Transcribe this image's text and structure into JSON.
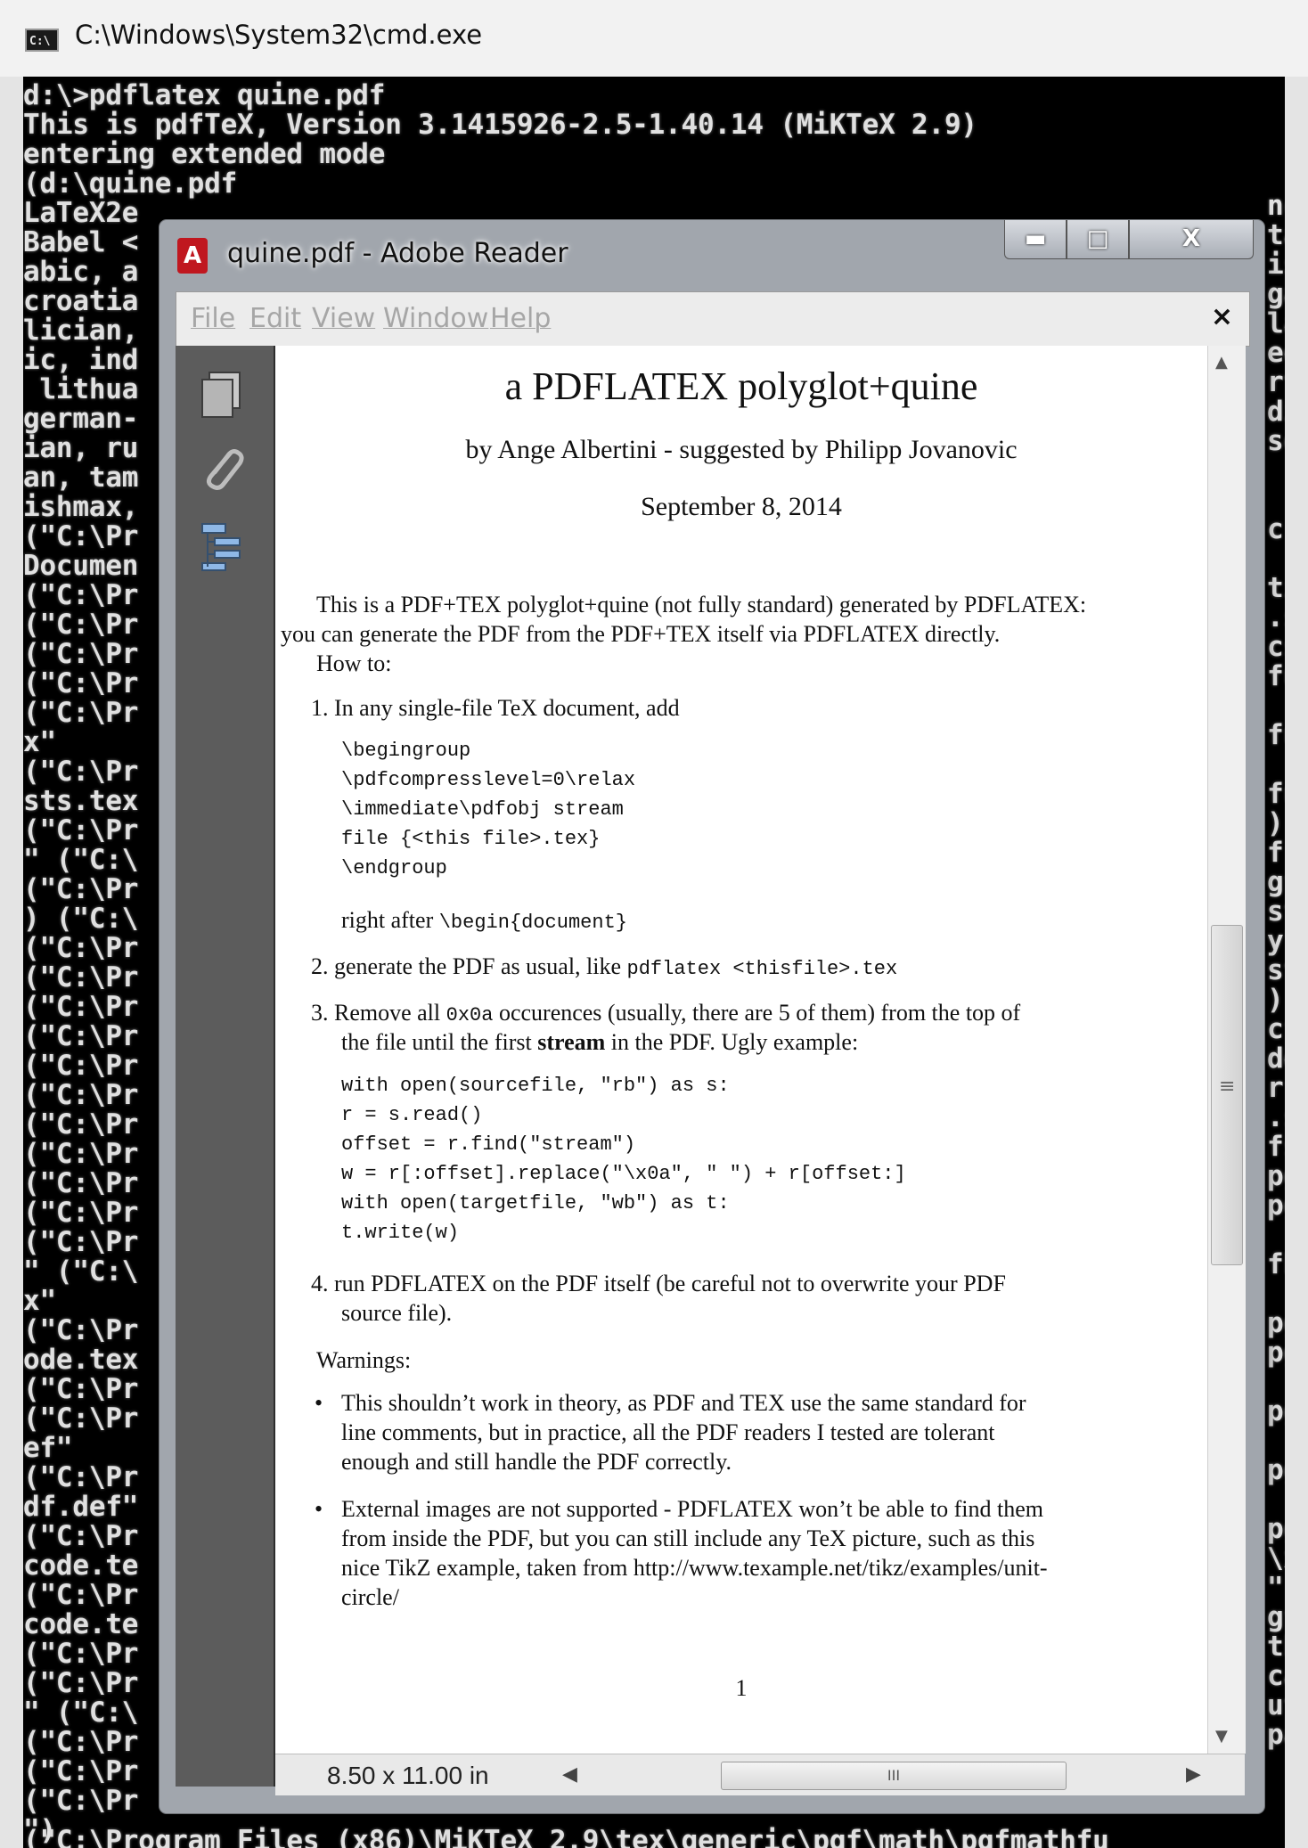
{
  "cmd": {
    "title": "C:\\Windows\\System32\\cmd.exe",
    "icon": "cmd-icon",
    "icon_text": "C:\\",
    "lines_full": [
      "d:\\>pdflatex quine.pdf",
      "This is pdfTeX, Version 3.1415926-2.5-1.40.14 (MiKTeX 2.9)",
      "entering extended mode",
      "(d:\\quine.pdf"
    ],
    "lines_left": [
      "LaTeX2e",
      "Babel <",
      "abic, a",
      "croatia",
      "lician,",
      "ic, ind",
      " lithua",
      "german-",
      "ian, ru",
      "an, tam",
      "ishmax,",
      "(\"C:\\Pr",
      "Documen",
      "(\"C:\\Pr",
      "(\"C:\\Pr",
      "(\"C:\\Pr",
      "(\"C:\\Pr",
      "(\"C:\\Pr",
      "x\"",
      "(\"C:\\Pr",
      "sts.tex",
      "(\"C:\\Pr",
      "\" (\"C:\\",
      "(\"C:\\Pr",
      ") (\"C:\\",
      "(\"C:\\Pr",
      "(\"C:\\Pr",
      "(\"C:\\Pr",
      "(\"C:\\Pr",
      "(\"C:\\Pr",
      "(\"C:\\Pr",
      "(\"C:\\Pr",
      "(\"C:\\Pr",
      "(\"C:\\Pr",
      "(\"C:\\Pr",
      "(\"C:\\Pr",
      "\" (\"C:\\",
      "x\"",
      "(\"C:\\Pr",
      "ode.tex",
      "(\"C:\\Pr",
      "(\"C:\\Pr",
      "ef\"",
      "(\"C:\\Pr",
      "df.def\"",
      "(\"C:\\Pr",
      "code.te",
      "(\"C:\\Pr",
      "code.te",
      "(\"C:\\Pr",
      "(\"C:\\Pr",
      "\" (\"C:\\",
      "(\"C:\\Pr",
      "(\"C:\\Pr",
      "(\"C:\\Pr",
      "\")"
    ],
    "lines_right": [
      "nc",
      "ta",
      "is",
      "ga",
      "la",
      "ee",
      "rt",
      "di",
      "so",
      "",
      "",
      "c",
      "",
      "ti",
      ".s",
      "cs",
      "fu",
      "",
      "fu",
      "",
      "fu",
      "))",
      "fr",
      "gf",
      "st",
      "y\"",
      "st",
      ")",
      "cf",
      "de",
      "rr",
      ".s",
      "fs",
      "pg",
      "pg",
      "",
      "fk",
      "",
      "pg",
      "pg",
      "",
      "pg",
      "",
      "pg",
      "",
      "pg",
      "\\x",
      "\")",
      "gf",
      "th",
      "ca",
      "ut",
      "pa"
    ],
    "bottom_line": "(\"C:\\Program Files (x86)\\MiKTeX 2.9\\tex\\generic\\pgf\\math\\pgfmathfu"
  },
  "reader": {
    "title": "quine.pdf - Adobe Reader",
    "icon": "adobe-pdf-icon",
    "icon_text": "A",
    "buttons": {
      "minimize": "minimize-icon",
      "maximize": "maximize-icon",
      "close": "close-icon",
      "min_glyph": "▬",
      "max_glyph": "□",
      "close_glyph": "X"
    },
    "menu": [
      "File",
      "Edit",
      "View",
      "Window",
      "Help"
    ],
    "menu_close": "×",
    "nav_icons": [
      "pages-icon",
      "attachments-icon",
      "bookmarks-icon"
    ],
    "status": {
      "page_size": "8.50 x 11.00 in",
      "thumb_grip": "III",
      "left_arrow": "◀",
      "right_arrow": "▶",
      "up_arrow": "▲",
      "down_arrow": "▼",
      "vgrip": "≡"
    }
  },
  "pdf": {
    "title": "a PDFLATEX polyglot+quine",
    "author": "by Ange Albertini - suggested by Philipp Jovanovic",
    "date": "September 8, 2014",
    "intro_1": "This is a PDF+TEX polyglot+quine (not fully standard) generated by PDFLATEX:",
    "intro_2": "you can generate the PDF from the PDF+TEX itself via PDFLATEX directly.",
    "howto": "How to:",
    "step1": "1.  In any single-file TeX document, add",
    "code1": [
      "\\begingroup",
      "  \\pdfcompresslevel=0\\relax",
      "  \\immediate\\pdfobj stream",
      "    file {<this file>.tex}",
      "\\endgroup"
    ],
    "step1_after": "right after ",
    "step1_after_code": "\\begin{document}",
    "step2": "2.  generate the PDF as usual, like ",
    "step2_code": "pdflatex <thisfile>.tex",
    "step3_a": "3.  Remove all ",
    "step3_code": "0x0a",
    "step3_b": " occurences (usually, there are 5 of them) from the top of",
    "step3_line2_a": "the file until the first ",
    "step3_bold": "stream",
    "step3_line2_b": " in the PDF. Ugly example:",
    "code2": [
      "with open(sourcefile, \"rb\") as s:",
      "    r = s.read()",
      "offset = r.find(\"stream\")",
      "w = r[:offset].replace(\"\\x0a\", \" \") + r[offset:]",
      "with open(targetfile, \"wb\") as t:",
      "    t.write(w)"
    ],
    "step4_line1": "4.  run PDFLATEX on the PDF itself (be careful not to overwrite your PDF",
    "step4_line2": "source file).",
    "warnings": "Warnings:",
    "bullet1": [
      "This shouldn’t work in theory, as PDF and TEX use the same standard for",
      "line comments, but in practice, all the PDF readers I tested are tolerant",
      "enough and still handle the PDF correctly."
    ],
    "bullet2": [
      "External images are not supported - PDFLATEX won’t be able to find them",
      "from inside the PDF, but you can still include any TeX picture, such as this",
      "nice TikZ example, taken from http://www.texample.net/tikz/examples/unit-",
      "circle/"
    ],
    "bullet_glyph": "•",
    "page_number": "1"
  }
}
